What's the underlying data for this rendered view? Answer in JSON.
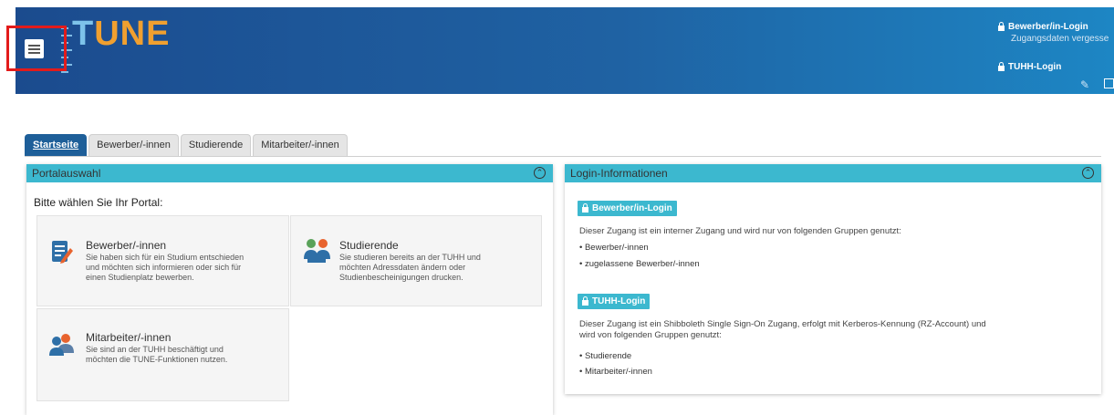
{
  "header": {
    "logo_t": "T",
    "logo_une": "UNE",
    "applicant_login": "Bewerber/in-Login",
    "forgot_credentials": "Zugangsdaten vergesse",
    "tuhh_login": "TUHH-Login"
  },
  "tabs": [
    {
      "label": "Startseite"
    },
    {
      "label": "Bewerber/-innen"
    },
    {
      "label": "Studierende"
    },
    {
      "label": "Mitarbeiter/-innen"
    }
  ],
  "portal_panel": {
    "title": "Portalauswahl",
    "choose_label": "Bitte wählen Sie Ihr Portal:",
    "portals": [
      {
        "title": "Bewerber/-innen",
        "desc1": "Sie haben sich für ein Studium entschieden",
        "desc2": "und möchten sich informieren oder sich für",
        "desc3": "einen Studienplatz bewerben."
      },
      {
        "title": "Studierende",
        "desc1": "Sie studieren bereits an der TUHH und",
        "desc2": "möchten Adressdaten ändern oder",
        "desc3": "Studienbescheinigungen drucken."
      },
      {
        "title": "Mitarbeiter/-innen",
        "desc1": "Sie sind an der TUHH beschäftigt und",
        "desc2": "möchten die TUNE-Funktionen nutzen.",
        "desc3": ""
      }
    ]
  },
  "login_panel": {
    "title": "Login-Informationen",
    "applicant_badge": "Bewerber/in-Login",
    "applicant_text": "Dieser Zugang ist ein interner Zugang und wird nur von folgenden Gruppen genutzt:",
    "applicant_groups": [
      "• Bewerber/-innen",
      "• zugelassene Bewerber/-innen"
    ],
    "tuhh_badge": "TUHH-Login",
    "tuhh_text1": "Dieser Zugang ist ein Shibboleth Single Sign-On Zugang, erfolgt mit Kerberos-Kennung (RZ-Account) und",
    "tuhh_text2": "wird von folgenden Gruppen genutzt:",
    "tuhh_groups": [
      "• Studierende",
      "• Mitarbeiter/-innen"
    ]
  },
  "colors": {
    "header_start": "#1b4b8e",
    "header_end": "#1d86c4",
    "accent": "#3cb8cf",
    "highlight": "#e21b1b"
  }
}
